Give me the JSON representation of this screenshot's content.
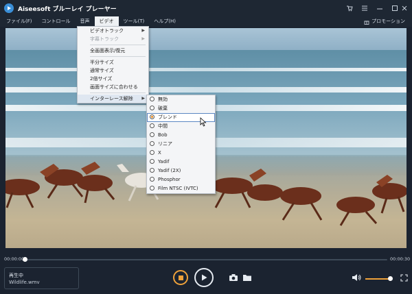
{
  "window": {
    "title": "Aiseesoft ブルーレイ プレーヤー"
  },
  "menubar": {
    "items": [
      "ファイル(F)",
      "コントロール",
      "音声",
      "ビデオ",
      "ツール(T)",
      "ヘルプ(H)"
    ],
    "promotion": "プロモーション"
  },
  "video_menu": {
    "items": [
      "ビデオトラック",
      "字幕トラック",
      "全画面表示/復元",
      "半分サイズ",
      "通常サイズ",
      "2倍サイズ",
      "画面サイズに合わせる",
      "インターレース解除"
    ]
  },
  "deinterlace_menu": {
    "items": [
      "無効",
      "破棄",
      "ブレンド",
      "中間",
      "Bob",
      "リニア",
      "X",
      "Yadif",
      "Yadif (2X)",
      "Phosphor",
      "Film NTSC (IVTC)"
    ],
    "selected": "ブレンド"
  },
  "playback": {
    "current_time": "00:00:00",
    "total_time": "00:00:30",
    "progress": 0.0,
    "volume": 0.85
  },
  "status": {
    "state": "再生中",
    "file": "Wildlife.wmv"
  },
  "colors": {
    "accent": "#f0a23a",
    "background": "#1b2330"
  }
}
